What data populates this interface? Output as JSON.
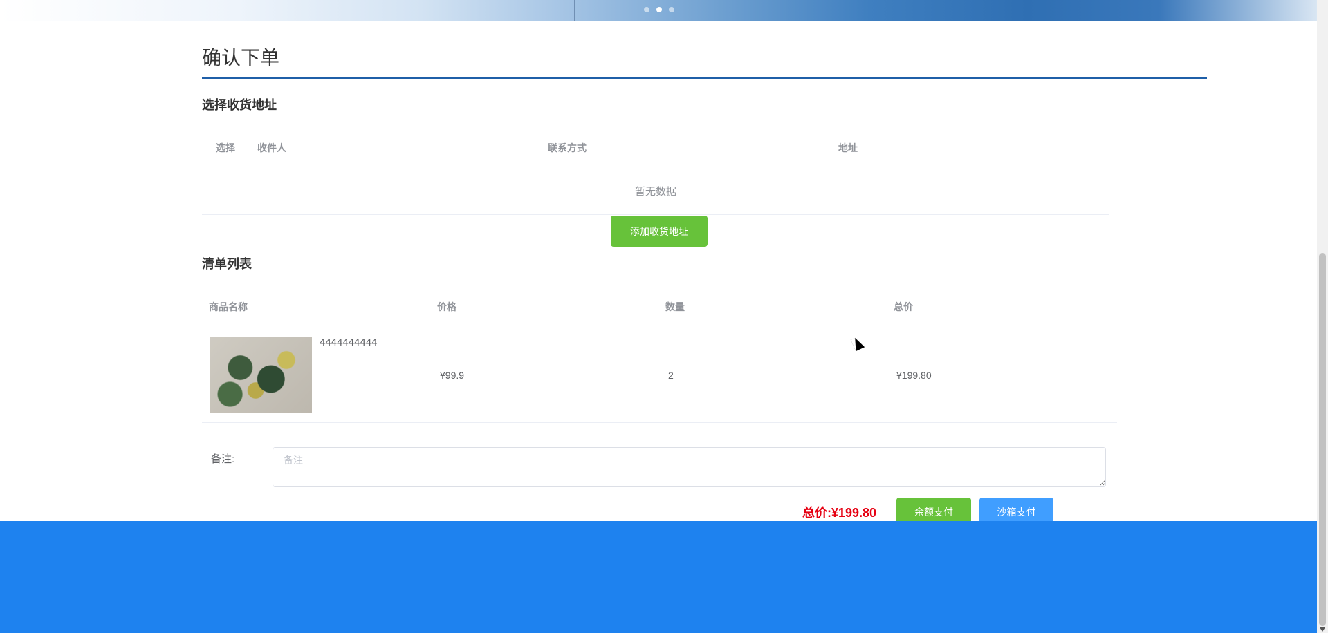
{
  "page": {
    "title": "确认下单"
  },
  "banner": {
    "dots": 3,
    "active_dot": 1
  },
  "address": {
    "section_title": "选择收货地址",
    "columns": [
      "选择",
      "收件人",
      "联系方式",
      "地址"
    ],
    "empty_text": "暂无数据",
    "add_button": "添加收货地址"
  },
  "goods": {
    "section_title": "清单列表",
    "columns": [
      "商品名称",
      "价格",
      "数量",
      "总价"
    ],
    "rows": [
      {
        "name": "4444444444",
        "price": "¥99.9",
        "qty": "2",
        "subtotal": "¥199.80"
      }
    ]
  },
  "remark": {
    "label": "备注:",
    "placeholder": "备注"
  },
  "summary": {
    "total_label": "总价:",
    "total_value": "¥199.80",
    "pay_balance": "余额支付",
    "pay_sandbox": "沙箱支付"
  },
  "colors": {
    "primary_green": "#67c23a",
    "primary_blue": "#409eff",
    "price_red": "#e60012",
    "footer_blue": "#1e82ef",
    "title_underline": "#1f5fa8"
  }
}
